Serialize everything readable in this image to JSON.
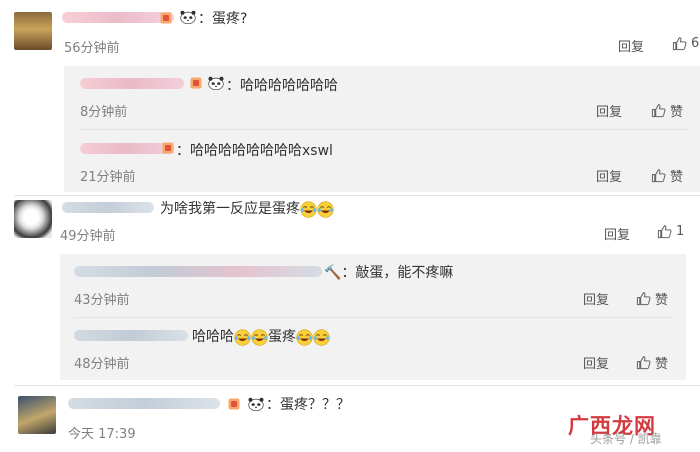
{
  "comments": [
    {
      "text": "：蛋疼?",
      "time": "56分钟前",
      "reply": "回复",
      "likes": "6"
    },
    {
      "text": "为啥我第一反应是蛋疼",
      "time": "49分钟前",
      "reply": "回复",
      "likes": "1"
    },
    {
      "text": "：蛋疼？？？",
      "time": "今天 17:39"
    }
  ],
  "replies_a": [
    {
      "text": "：哈哈哈哈哈哈哈",
      "time": "8分钟前",
      "reply": "回复",
      "like_label": "赞"
    },
    {
      "text": "：哈哈哈哈哈哈哈哈xswl",
      "time": "21分钟前",
      "reply": "回复",
      "like_label": "赞"
    }
  ],
  "replies_b": [
    {
      "text": "：敲蛋，能不疼嘛",
      "time": "43分钟前",
      "reply": "回复",
      "like_label": "赞"
    },
    {
      "text_prefix": "哈哈哈",
      "text_mid": "蛋疼",
      "time": "48分钟前",
      "reply": "回复",
      "like_label": "赞"
    }
  ],
  "watermark": {
    "brand": "广西龙网",
    "sub": "头条号 / 凯靠"
  },
  "colors": {
    "reply_bg": "#f2f2f2",
    "time": "#808080",
    "blur_pink": "#f7c6cf",
    "watermark": "#d0262c"
  }
}
